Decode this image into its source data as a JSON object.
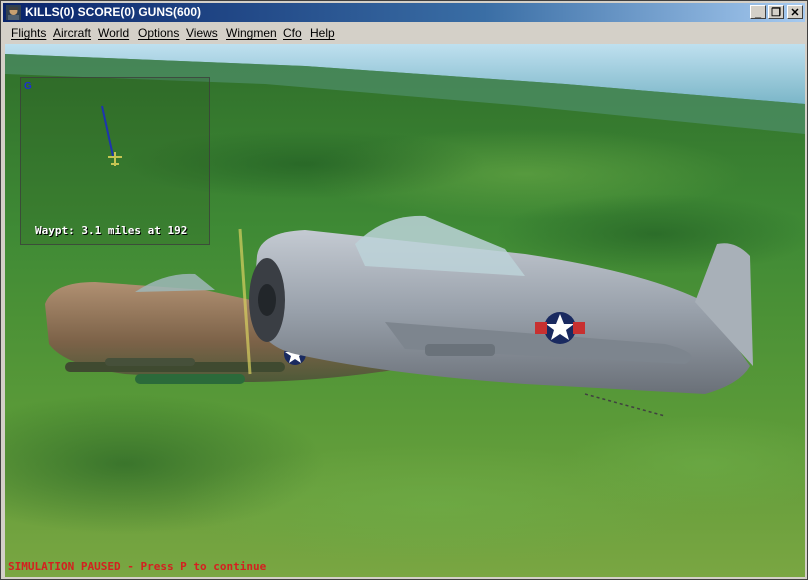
{
  "window": {
    "title": "KILLS(0) SCORE(0) GUNS(600)",
    "icon": "pilot-icon",
    "controls": {
      "minimize": "_",
      "restore": "❐",
      "close": "✕"
    }
  },
  "menu": {
    "items": [
      {
        "label": "Flights"
      },
      {
        "label": "Aircraft"
      },
      {
        "label": "World"
      },
      {
        "label": "Options"
      },
      {
        "label": "Views"
      },
      {
        "label": "Wingmen"
      },
      {
        "label": "Cfo"
      },
      {
        "label": "Help"
      }
    ]
  },
  "hud": {
    "radar_north": "G",
    "waypoint": "Waypt: 3.1 miles at 192",
    "status": "SIMULATION PAUSED - Press P to continue"
  },
  "colors": {
    "status_text": "#d42020",
    "radar_heading": "#1c2fd0",
    "player_marker": "#e8e060"
  }
}
